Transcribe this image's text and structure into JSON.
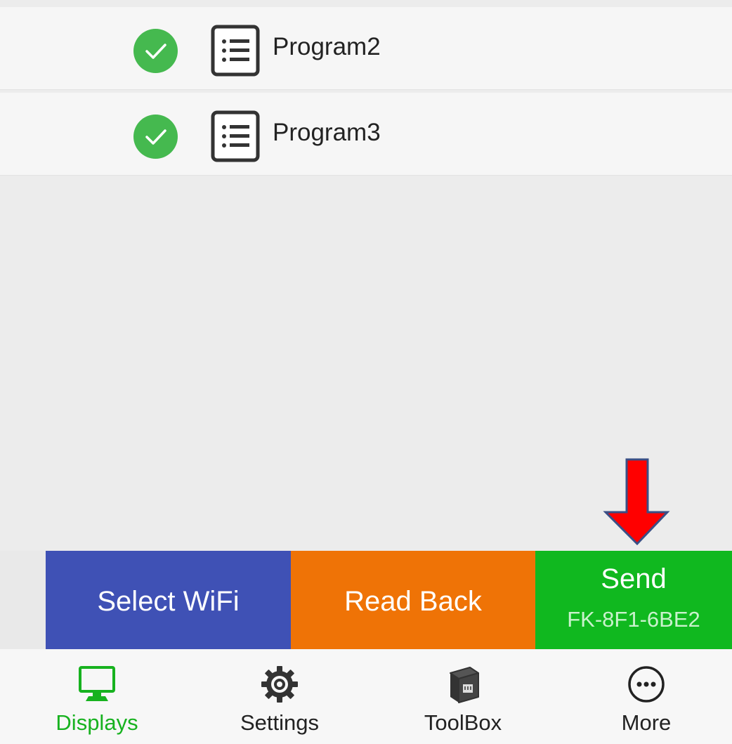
{
  "programs": [
    {
      "label": "Program2",
      "checked": true
    },
    {
      "label": "Program3",
      "checked": true
    }
  ],
  "actions": {
    "select_wifi": "Select WiFi",
    "read_back": "Read Back",
    "send": "Send",
    "device_id": "FK-8F1-6BE2"
  },
  "bottom_nav": [
    {
      "label": "Displays",
      "icon": "monitor-icon",
      "active": true
    },
    {
      "label": "Settings",
      "icon": "gear-icon",
      "active": false
    },
    {
      "label": "ToolBox",
      "icon": "toolbox-icon",
      "active": false
    },
    {
      "label": "More",
      "icon": "more-icon",
      "active": false
    }
  ],
  "colors": {
    "check_green": "#45b94f",
    "wifi_blue": "#3f51b5",
    "read_orange": "#ef7306",
    "send_green": "#10b81f",
    "active_nav": "#17b21f",
    "annotation_arrow": "#ff0000"
  }
}
